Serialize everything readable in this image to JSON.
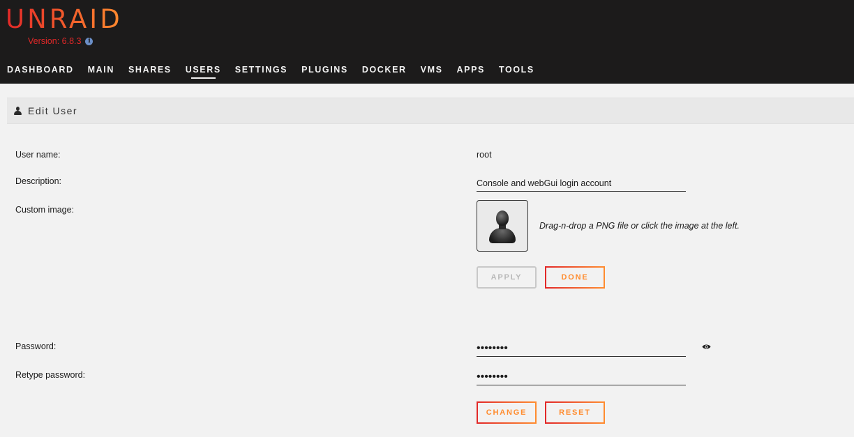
{
  "header": {
    "logo_text": "UNRAID",
    "version_label": "Version: 6.8.3",
    "info_icon": "info-icon"
  },
  "nav": {
    "items": [
      {
        "label": "DASHBOARD"
      },
      {
        "label": "MAIN"
      },
      {
        "label": "SHARES"
      },
      {
        "label": "USERS"
      },
      {
        "label": "SETTINGS"
      },
      {
        "label": "PLUGINS"
      },
      {
        "label": "DOCKER"
      },
      {
        "label": "VMS"
      },
      {
        "label": "APPS"
      },
      {
        "label": "TOOLS"
      }
    ],
    "active": "USERS"
  },
  "page": {
    "title": "Edit User",
    "title_icon": "user-icon"
  },
  "form": {
    "username_label": "User name:",
    "username_value": "root",
    "description_label": "Description:",
    "description_value": "Console and webGui login account",
    "custom_image_label": "Custom image:",
    "custom_image_hint": "Drag-n-drop a PNG file or click the image at the left.",
    "apply_label": "APPLY",
    "done_label": "DONE",
    "password_label": "Password:",
    "password_value": "••••••••",
    "retype_label": "Retype password:",
    "retype_value": "••••••••",
    "change_label": "CHANGE",
    "reset_label": "RESET",
    "eye_icon": "eye-icon"
  },
  "colors": {
    "brand_red": "#e22828",
    "brand_orange": "#ff8c2f",
    "header_bg": "#1c1b1b",
    "page_bg": "#f2f2f2"
  }
}
